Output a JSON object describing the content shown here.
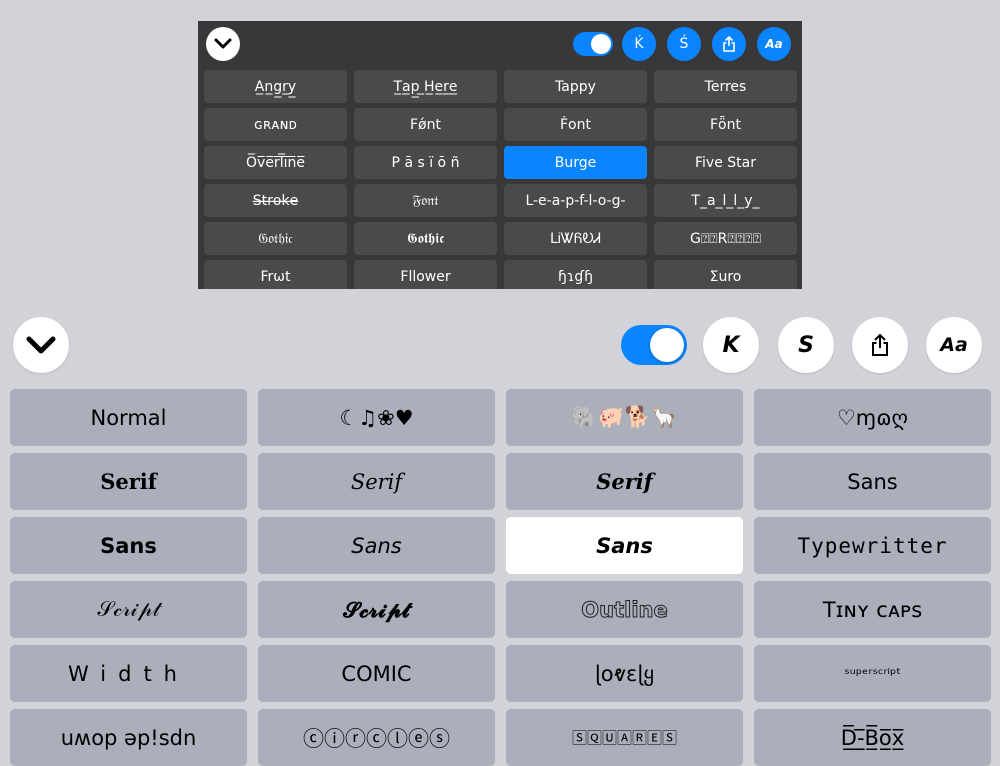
{
  "preview": {
    "toolbar": {
      "collapse_icon": "chevron-down-icon",
      "toggle_on": true,
      "buttons": [
        {
          "label": "Ḱ",
          "icon": "k-letter-icon"
        },
        {
          "label": "Ś",
          "icon": "s-letter-icon"
        },
        {
          "label": "⇪",
          "icon": "share-icon"
        },
        {
          "label": "Aa",
          "icon": "font-style-icon"
        }
      ]
    },
    "keys": [
      "A̲n̲g̲r̲y̲",
      "T̲a̲p̲ ̲H̲e̲r̲e̲",
      "Tappy",
      "Terres",
      "ɢʀᴀɴᴅ",
      "Fǿnt",
      "Ḟont",
      "Fȫnt",
      "O̅v̅e̅r̅l̅i̅n̅e̅",
      "P ā s ï ō ñ",
      "Burge",
      "Five Star",
      "S̶t̶r̶o̶k̶e̶",
      "𝔉𝔬𝔫𝔱",
      "L-e-a-p-f-l-o-g-",
      "T_a_l_l_y_",
      "𝔊𝔬𝔱𝔥𝔦𝔠",
      "𝕲𝖔𝖙𝖍𝖎𝖈",
      "LᎥᏔᏲᎧᏗ",
      "G⍰⍰R⍰⍰⍰⍰",
      "Frωt",
      "Fllower",
      "ɧɿɠɧ",
      "Σuro"
    ],
    "selected_key": "Burge",
    "colors": {
      "panel": "#38383a",
      "key": "#4a4a4d",
      "accent": "#0a84ff"
    }
  },
  "toolbar": {
    "collapse_icon": "chevron-down-icon",
    "toggle_on": true,
    "buttons": [
      {
        "label": "K",
        "icon": "k-letter-icon"
      },
      {
        "label": "S",
        "icon": "s-letter-icon"
      },
      {
        "label": "⇪",
        "icon": "share-icon"
      },
      {
        "label": "Aa",
        "icon": "font-style-icon"
      }
    ]
  },
  "font_keys": [
    {
      "label": "Normal",
      "style": ""
    },
    {
      "label": "☾♫❀♥",
      "style": ""
    },
    {
      "label": "🐘🐖🐕🦙",
      "style": ""
    },
    {
      "label": "♡ɱɷღ",
      "style": ""
    },
    {
      "label": "Serif",
      "style": "style-serif b"
    },
    {
      "label": "Serif",
      "style": "style-serif i wide-s"
    },
    {
      "label": "Serif",
      "style": "style-serif b i"
    },
    {
      "label": "Sans",
      "style": ""
    },
    {
      "label": "Sans",
      "style": "b"
    },
    {
      "label": "Sans",
      "style": "i"
    },
    {
      "label": "Sans",
      "style": "b i"
    },
    {
      "label": "Typewritter",
      "style": "style-mono"
    },
    {
      "label": "𝒮𝒸𝓇𝒾𝓅𝓉",
      "style": "style-serif"
    },
    {
      "label": "𝓢𝓬𝓻𝓲𝓹𝓽",
      "style": "style-serif b"
    },
    {
      "label": "Outline",
      "style": "outline"
    },
    {
      "label": "Tɪɴʏ ᴄᴀᴘꜱ",
      "style": ""
    },
    {
      "label": "Width",
      "style": "wide"
    },
    {
      "label": "COMIC",
      "style": ""
    },
    {
      "label": "ɭoⱴɛɭყ",
      "style": ""
    },
    {
      "label": "ˢᵘᵖᵉʳˢᶜʳⁱᵖᵗ",
      "style": "small"
    },
    {
      "label": "uʍop ǝp!sdn",
      "style": ""
    },
    {
      "label": "ⓒⓘⓡⓒⓛⓔⓢ",
      "style": ""
    },
    {
      "label": "🅂🅀🅄🄰🅁🄴🅂",
      "style": "small"
    },
    {
      "label": "D̲̅-̲̅B̲̅o̲̅x̲̅",
      "style": ""
    }
  ],
  "selected_font_key": 10,
  "colors": {
    "background": "#d1d3d9",
    "key": "#abaebb",
    "selected_key": "#ffffff",
    "accent": "#0a84ff"
  }
}
